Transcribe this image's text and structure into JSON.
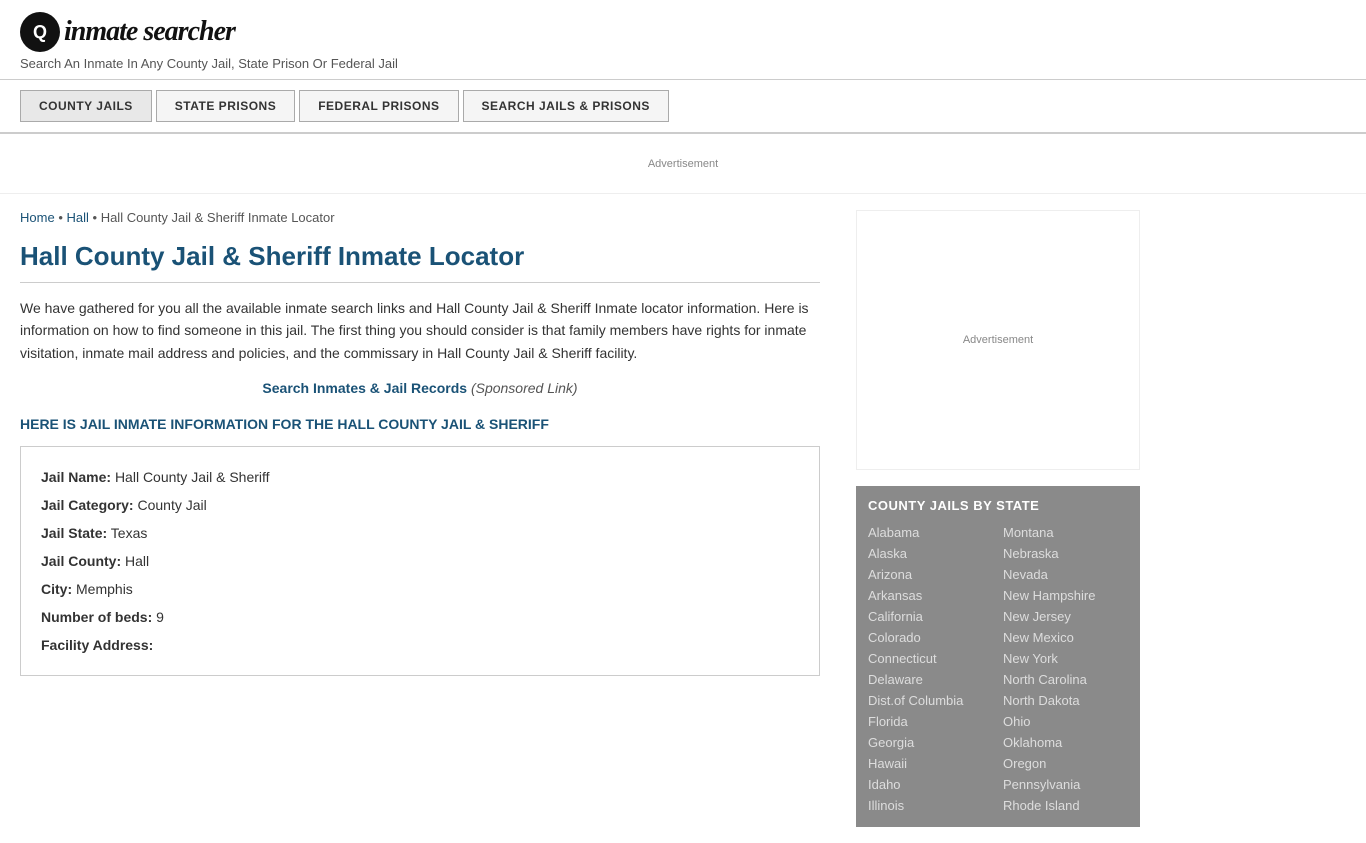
{
  "header": {
    "logo_icon": "🔍",
    "logo_text_prefix": "inmate",
    "logo_text_suffix": "searcher",
    "tagline": "Search An Inmate In Any County Jail, State Prison Or Federal Jail"
  },
  "nav": {
    "items": [
      {
        "id": "county-jails",
        "label": "COUNTY JAILS",
        "active": true
      },
      {
        "id": "state-prisons",
        "label": "STATE PRISONS",
        "active": false
      },
      {
        "id": "federal-prisons",
        "label": "FEDERAL PRISONS",
        "active": false
      },
      {
        "id": "search-jails",
        "label": "SEARCH JAILS & PRISONS",
        "active": false
      }
    ]
  },
  "ad_banner": "Advertisement",
  "breadcrumb": {
    "home": "Home",
    "hall": "Hall",
    "current": "Hall County Jail & Sheriff Inmate Locator"
  },
  "page_title": "Hall County Jail & Sheriff Inmate Locator",
  "description": "We have gathered for you all the available inmate search links and Hall County Jail & Sheriff Inmate locator information. Here is information on how to find someone in this jail. The first thing you should consider is that family members have rights for inmate visitation, inmate mail address and policies, and the commissary in Hall County Jail & Sheriff facility.",
  "search_link": {
    "label": "Search Inmates & Jail Records",
    "sponsored": "(Sponsored Link)"
  },
  "info_heading": "HERE IS JAIL INMATE INFORMATION FOR THE HALL COUNTY JAIL & SHERIFF",
  "info_box": {
    "jail_name_label": "Jail Name:",
    "jail_name": "Hall County Jail & Sheriff",
    "jail_category_label": "Jail Category:",
    "jail_category": "County Jail",
    "jail_state_label": "Jail State:",
    "jail_state": "Texas",
    "jail_county_label": "Jail County:",
    "jail_county": "Hall",
    "city_label": "City:",
    "city": "Memphis",
    "beds_label": "Number of beds:",
    "beds": "9",
    "facility_address_label": "Facility Address:"
  },
  "sidebar": {
    "ad_label": "Advertisement",
    "county_jails_title": "COUNTY JAILS BY STATE",
    "states_left": [
      "Alabama",
      "Alaska",
      "Arizona",
      "Arkansas",
      "California",
      "Colorado",
      "Connecticut",
      "Delaware",
      "Dist.of Columbia",
      "Florida",
      "Georgia",
      "Hawaii",
      "Idaho",
      "Illinois"
    ],
    "states_right": [
      "Montana",
      "Nebraska",
      "Nevada",
      "New Hampshire",
      "New Jersey",
      "New Mexico",
      "New York",
      "North Carolina",
      "North Dakota",
      "Ohio",
      "Oklahoma",
      "Oregon",
      "Pennsylvania",
      "Rhode Island"
    ]
  }
}
